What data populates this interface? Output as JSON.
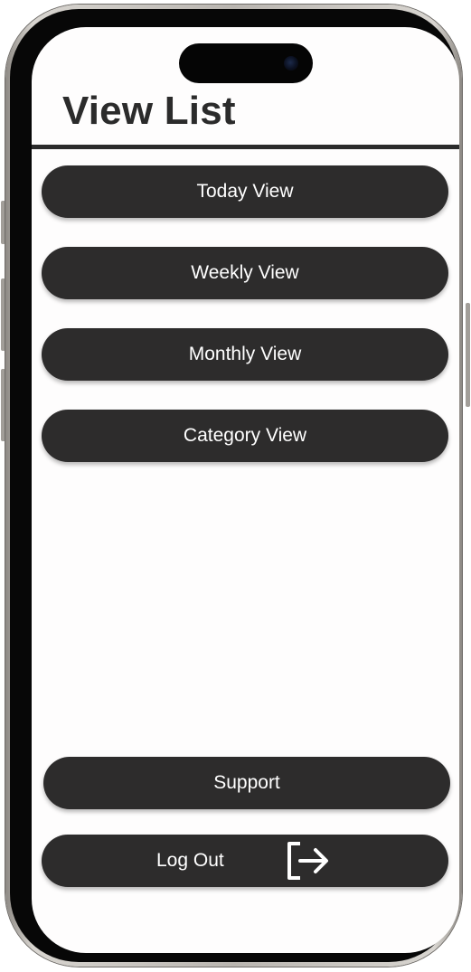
{
  "header": {
    "title": "View List"
  },
  "views": [
    {
      "label": "Today View"
    },
    {
      "label": "Weekly View"
    },
    {
      "label": "Monthly View"
    },
    {
      "label": "Category View"
    }
  ],
  "footer": {
    "support_label": "Support",
    "logout_label": "Log Out",
    "logout_icon": "logout-icon"
  },
  "colors": {
    "button_bg": "#2d2c2c",
    "button_text": "#ffffff",
    "title_text": "#2b2b2b",
    "screen_bg": "#fefdfd"
  }
}
